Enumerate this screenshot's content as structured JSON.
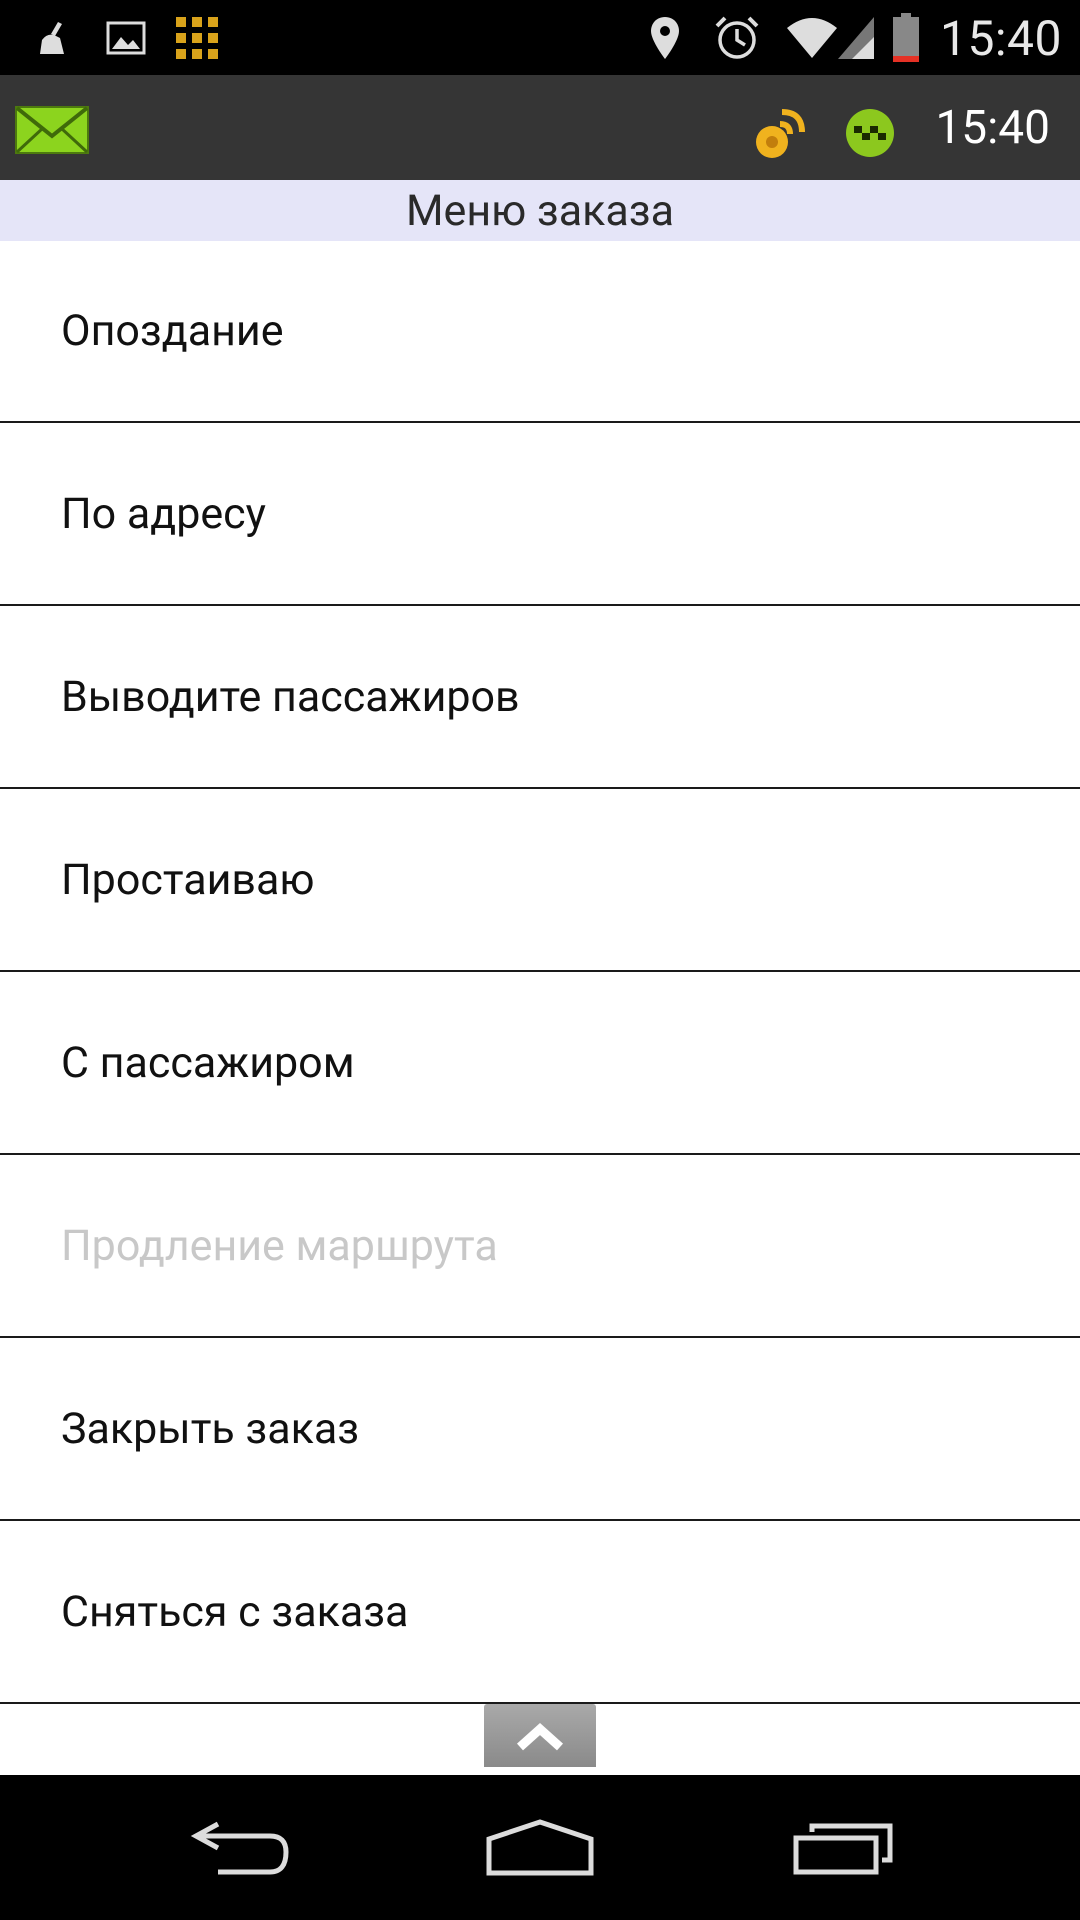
{
  "status_bar": {
    "icons": [
      "cleaner-icon",
      "gallery-icon",
      "grid-app-icon",
      "location-icon",
      "alarm-icon",
      "wifi-icon",
      "signal-icon",
      "battery-icon"
    ],
    "time": "15:40"
  },
  "app_bar": {
    "icons": [
      "mail-icon",
      "gps-signal-icon",
      "taxi-status-icon"
    ],
    "time": "15:40",
    "colors": {
      "mail": "#8cd41e",
      "gps": "#f0b21e",
      "taxi": "#8cc81e"
    }
  },
  "menu": {
    "title": "Меню заказа",
    "items": [
      {
        "label": "Опоздание",
        "enabled": true
      },
      {
        "label": "По адресу",
        "enabled": true
      },
      {
        "label": "Выводите пассажиров",
        "enabled": true
      },
      {
        "label": "Простаиваю",
        "enabled": true
      },
      {
        "label": "С пассажиром",
        "enabled": true
      },
      {
        "label": "Продление маршрута",
        "enabled": false
      },
      {
        "label": "Закрыть заказ",
        "enabled": true
      },
      {
        "label": "Сняться с заказа",
        "enabled": true
      }
    ]
  },
  "nav_bar": {
    "buttons": [
      "back-icon",
      "home-icon",
      "recent-apps-icon"
    ]
  }
}
